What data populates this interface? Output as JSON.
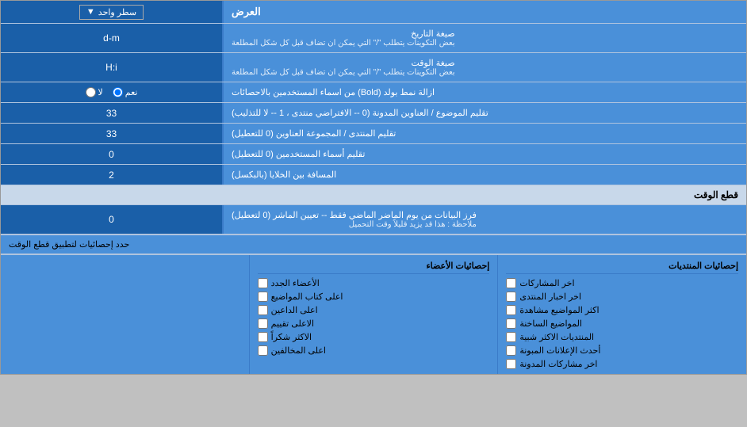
{
  "header": {
    "label": "العرض",
    "dropdown_label": "سطر واحد"
  },
  "rows": [
    {
      "id": "date-format",
      "label": "صيغة التاريخ",
      "sublabel": "بعض التكوينات يتطلب \"/\" التي يمكن ان تضاف قبل كل شكل المطلعة",
      "value": "d-m"
    },
    {
      "id": "time-format",
      "label": "صيغة الوقت",
      "sublabel": "بعض التكوينات يتطلب \"/\" التي يمكن ان تضاف قبل كل شكل المطلعة",
      "value": "H:i"
    },
    {
      "id": "remove-bold",
      "label": "ازالة نمط بولد (Bold) من اسماء المستخدمين بالاحصائات",
      "radio_options": [
        {
          "value": "yes",
          "label": "نعم",
          "checked": true
        },
        {
          "value": "no",
          "label": "لا",
          "checked": false
        }
      ]
    },
    {
      "id": "topic-address",
      "label": "تقليم الموضوع / العناوين المدونة (0 -- الافتراضي منتدى ، 1 -- لا للتذليب)",
      "value": "33"
    },
    {
      "id": "forum-group",
      "label": "تقليم المنتدى / المجموعة العناوين (0 للتعطيل)",
      "value": "33"
    },
    {
      "id": "usernames",
      "label": "تقليم أسماء المستخدمين (0 للتعطيل)",
      "value": "0"
    },
    {
      "id": "cell-spacing",
      "label": "المسافة بين الخلايا (بالبكسل)",
      "value": "2"
    }
  ],
  "section_cutoff": {
    "title": "قطع الوقت",
    "row": {
      "id": "cutoff-days",
      "label": "فرز البيانات من يوم الماضر الماضي فقط -- تعيين الماشر (0 لتعطيل)",
      "note": "ملاحظة : هذا قد يزيد قليلاً وقت التحميل",
      "value": "0"
    }
  },
  "stats_section": {
    "limit_label": "حدد إحصائيات لتطبيق قطع الوقت",
    "col1": {
      "header": "إحصائيات المنتديات",
      "items": [
        {
          "label": "اخر المشاركات",
          "checked": false
        },
        {
          "label": "اخر اخبار المنتدى",
          "checked": false
        },
        {
          "label": "اكثر المواضيع مشاهدة",
          "checked": false
        },
        {
          "label": "المواضيع الساخنة",
          "checked": false
        },
        {
          "label": "المنتديات الاكثر شبية",
          "checked": false
        },
        {
          "label": "أحدث الإعلانات المبونة",
          "checked": false
        },
        {
          "label": "اخر مشاركات المدونة",
          "checked": false
        }
      ]
    },
    "col2": {
      "header": "إحصائيات الأعضاء",
      "items": [
        {
          "label": "الأعضاء الجدد",
          "checked": false
        },
        {
          "label": "اعلى كتاب المواضيع",
          "checked": false
        },
        {
          "label": "اعلى الداعين",
          "checked": false
        },
        {
          "label": "الاعلى تقييم",
          "checked": false
        },
        {
          "label": "الاكثر شكراً",
          "checked": false
        },
        {
          "label": "اعلى المخالفين",
          "checked": false
        }
      ]
    }
  }
}
